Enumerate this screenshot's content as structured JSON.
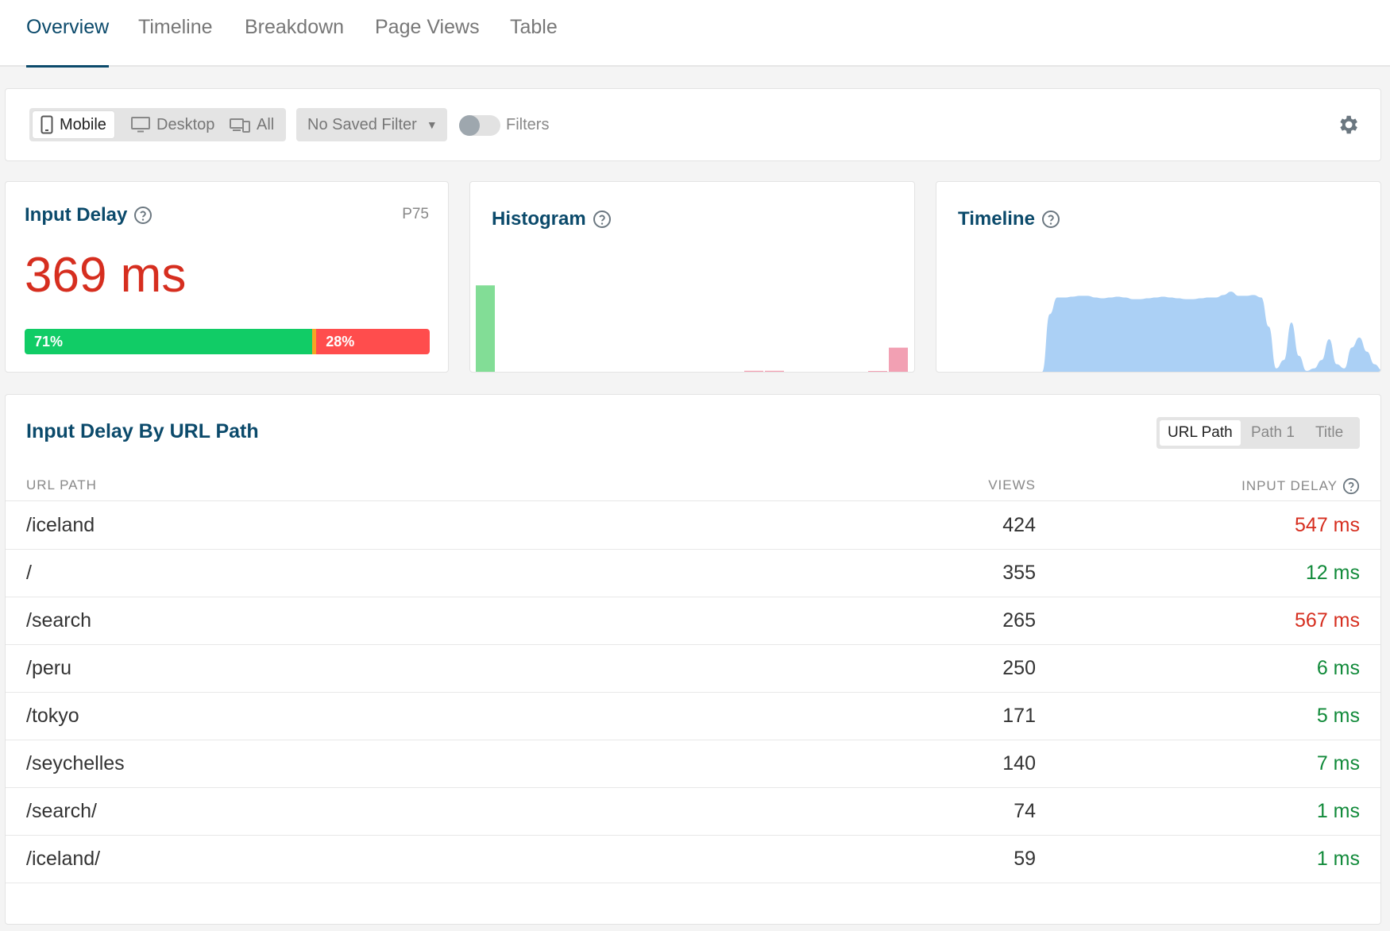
{
  "tabs": [
    {
      "label": "Overview",
      "active": true
    },
    {
      "label": "Timeline",
      "active": false
    },
    {
      "label": "Breakdown",
      "active": false
    },
    {
      "label": "Page Views",
      "active": false
    },
    {
      "label": "Table",
      "active": false
    }
  ],
  "filter_bar": {
    "device_options": [
      {
        "label": "Mobile",
        "icon": "mobile-icon",
        "active": true
      },
      {
        "label": "Desktop",
        "icon": "desktop-icon",
        "active": false
      },
      {
        "label": "All",
        "icon": "devices-icon",
        "active": false
      }
    ],
    "saved_filter": "No Saved Filter",
    "filters_label": "Filters",
    "filters_enabled": false,
    "settings_icon": "gear-icon"
  },
  "metric_card": {
    "title": "Input Delay",
    "percentile": "P75",
    "value": "369 ms",
    "distribution": {
      "good_pct": 71,
      "needs_improvement_pct": 1,
      "poor_pct": 28,
      "good_label": "71%",
      "poor_label": "28%"
    },
    "colors": {
      "good": "#11cc66",
      "needs_improvement": "#f5a623",
      "poor": "#ff4d4d",
      "value": "#d62e1f"
    }
  },
  "histogram": {
    "title": "Histogram",
    "buckets": [
      {
        "height": 0.98,
        "color": "#82dd96"
      },
      {
        "height": 0,
        "color": "#82dd96"
      },
      {
        "height": 0,
        "color": "#82dd96"
      },
      {
        "height": 0,
        "color": "#82dd96"
      },
      {
        "height": 0,
        "color": "#82dd96"
      },
      {
        "height": 0,
        "color": "#82dd96"
      },
      {
        "height": 0,
        "color": "#82dd96"
      },
      {
        "height": 0,
        "color": "#82dd96"
      },
      {
        "height": 0,
        "color": "#82dd96"
      },
      {
        "height": 0,
        "color": "#82dd96"
      },
      {
        "height": 0,
        "color": "#82dd96"
      },
      {
        "height": 0,
        "color": "#82dd96"
      },
      {
        "height": 0,
        "color": "#82dd96"
      },
      {
        "height": 0.02,
        "color": "#f2a0b3"
      },
      {
        "height": 0.02,
        "color": "#f2a0b3"
      },
      {
        "height": 0,
        "color": "#f2a0b3"
      },
      {
        "height": 0,
        "color": "#f2a0b3"
      },
      {
        "height": 0,
        "color": "#f2a0b3"
      },
      {
        "height": 0,
        "color": "#f2a0b3"
      },
      {
        "height": 0.01,
        "color": "#f2a0b3"
      },
      {
        "height": 0.28,
        "color": "#f2a0b3"
      }
    ]
  },
  "timeline": {
    "title": "Timeline",
    "color": "#abd0f5",
    "values": [
      0,
      0,
      0,
      0,
      0,
      0,
      0,
      0,
      0,
      0,
      0,
      0,
      0,
      0,
      0.01,
      0.7,
      0.9,
      0.9,
      0.91,
      0.92,
      0.92,
      0.9,
      0.89,
      0.9,
      0.91,
      0.9,
      0.88,
      0.88,
      0.89,
      0.9,
      0.91,
      0.9,
      0.89,
      0.88,
      0.88,
      0.89,
      0.9,
      0.9,
      0.93,
      0.97,
      0.92,
      0.92,
      0.93,
      0.9,
      0.55,
      0.05,
      0.15,
      0.6,
      0.2,
      0.02,
      0.05,
      0.15,
      0.4,
      0.1,
      0.05,
      0.3,
      0.42,
      0.25,
      0.1,
      0.03
    ]
  },
  "table": {
    "title": "Input Delay By URL Path",
    "group_options": [
      {
        "label": "URL Path",
        "active": true
      },
      {
        "label": "Path 1",
        "active": false
      },
      {
        "label": "Title",
        "active": false
      }
    ],
    "columns": [
      "URL PATH",
      "VIEWS",
      "INPUT DELAY"
    ],
    "rows": [
      {
        "path": "/iceland",
        "views": "424",
        "delay": "547 ms",
        "status": "poor"
      },
      {
        "path": "/",
        "views": "355",
        "delay": "12 ms",
        "status": "good"
      },
      {
        "path": "/search",
        "views": "265",
        "delay": "567 ms",
        "status": "poor"
      },
      {
        "path": "/peru",
        "views": "250",
        "delay": "6 ms",
        "status": "good"
      },
      {
        "path": "/tokyo",
        "views": "171",
        "delay": "5 ms",
        "status": "good"
      },
      {
        "path": "/seychelles",
        "views": "140",
        "delay": "7 ms",
        "status": "good"
      },
      {
        "path": "/search/",
        "views": "74",
        "delay": "1 ms",
        "status": "good"
      },
      {
        "path": "/iceland/",
        "views": "59",
        "delay": "1 ms",
        "status": "good"
      }
    ]
  }
}
